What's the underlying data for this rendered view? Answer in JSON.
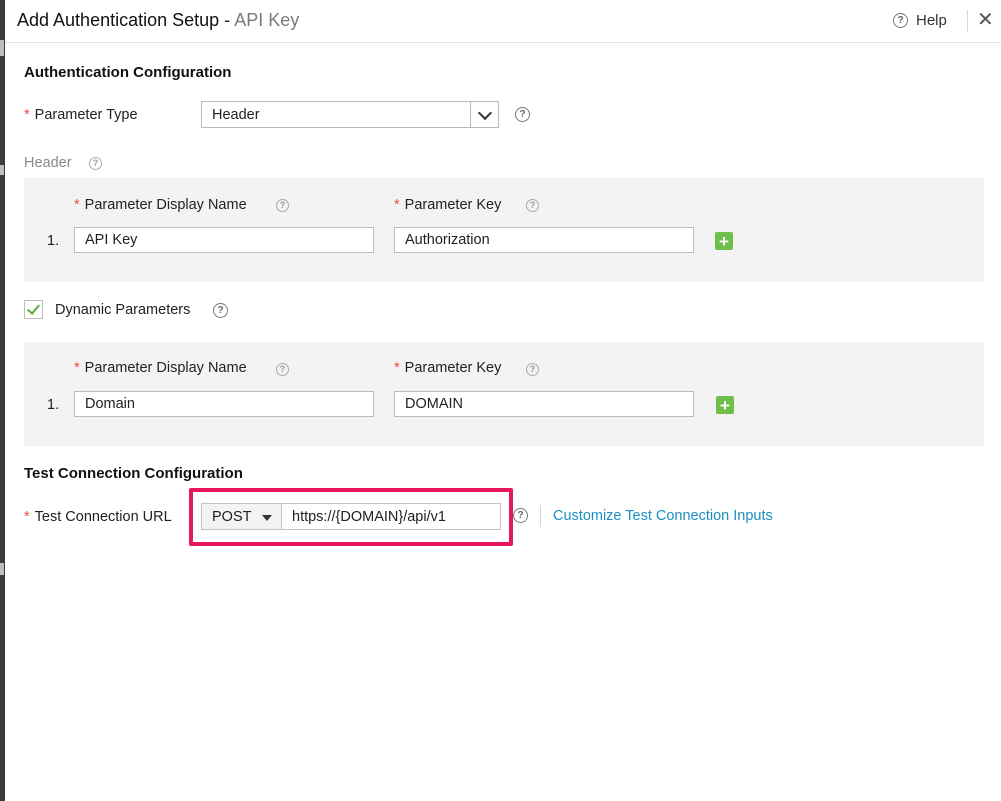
{
  "dialog": {
    "title": "Add Authentication Setup",
    "title_sep": " - ",
    "subtitle": "API Key",
    "help_label": "Help"
  },
  "auth_config": {
    "heading": "Authentication Configuration",
    "required_mark": "*",
    "parameter_type_label": "Parameter Type",
    "parameter_type_value": "Header",
    "header_label": "Header",
    "header_params": {
      "display_name_label": "Parameter Display Name",
      "key_label": "Parameter Key",
      "rows": [
        {
          "index": "1.",
          "display_name": "API Key",
          "key": "Authorization"
        }
      ]
    },
    "dynamic_parameters_label": "Dynamic Parameters",
    "dynamic_parameters_checked": true,
    "dynamic_params": {
      "display_name_label": "Parameter Display Name",
      "key_label": "Parameter Key",
      "rows": [
        {
          "index": "1.",
          "display_name": "Domain",
          "key": "DOMAIN"
        }
      ]
    }
  },
  "test_connection": {
    "heading": "Test Connection Configuration",
    "url_label": "Test Connection URL",
    "method": "POST",
    "url": "https://{DOMAIN}/api/v1",
    "customize_link": "Customize Test Connection Inputs"
  },
  "colors": {
    "required": "#e74c3c",
    "accent_link": "#1d8fc1",
    "add_button": "#6fbf4a",
    "highlight": "#e8175d",
    "panel_bg": "#f3f3f3"
  },
  "icons": [
    "help-icon",
    "close-icon",
    "chevron-down-icon",
    "plus-icon",
    "checkmark-icon",
    "caret-down-icon"
  ]
}
